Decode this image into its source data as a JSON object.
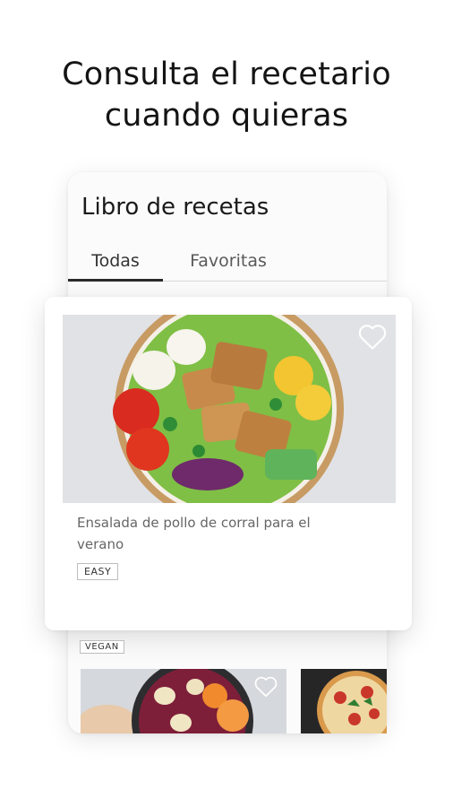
{
  "headline": {
    "line1": "Consulta el recetario",
    "line2": "cuando quieras"
  },
  "app": {
    "title": "Libro de recetas",
    "tabs": [
      {
        "label": "Todas",
        "active": true
      },
      {
        "label": "Favoritas",
        "active": false
      }
    ]
  },
  "featured_recipe": {
    "name": "Ensalada de pollo de corral para el verano",
    "badge": "EASY",
    "favorite": false
  },
  "next_recipe": {
    "badge": "VEGAN",
    "favorite": false
  },
  "colors": {
    "accent": "#2b2b2b",
    "card_bg": "#ffffff",
    "photo_bg": "#dfe0e4"
  }
}
